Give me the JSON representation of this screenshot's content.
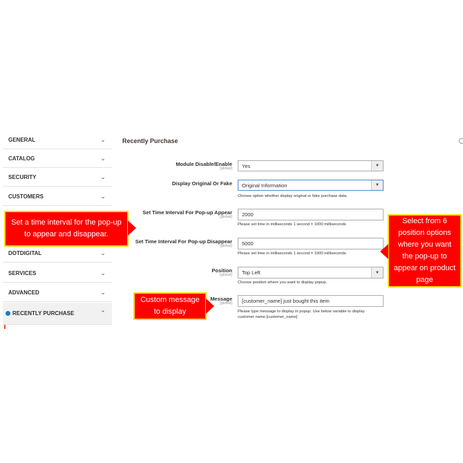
{
  "sidebar": {
    "items": [
      {
        "label": "GENERAL"
      },
      {
        "label": "CATALOG"
      },
      {
        "label": "SECURITY"
      },
      {
        "label": "CUSTOMERS"
      },
      {
        "label": "DOTDIGITAL"
      },
      {
        "label": "SERVICES"
      },
      {
        "label": "ADVANCED"
      },
      {
        "label": "RECENTLY PURCHASE"
      }
    ]
  },
  "section": {
    "title": "Recently Purchase"
  },
  "form": {
    "module": {
      "label": "Module Disable/Enable",
      "scope": "[global]",
      "value": "Yes"
    },
    "display": {
      "label": "Display Original Or Fake",
      "scope": "[global]",
      "value": "Original Information",
      "note": "Choose option whether display original or fake purchase data."
    },
    "appear": {
      "label": "Set Time Interval For Pop-up Appear",
      "scope": "[global]",
      "value": "2000",
      "note": "Please set time in milliseconds 1 second = 1000 milliseconds"
    },
    "disappear": {
      "label": "Set Time Interval For Pop-up Disappear",
      "scope": "[global]",
      "value": "5000",
      "note": "Please set time in milliseconds 1 second = 1000 milliseconds"
    },
    "position": {
      "label": "Position",
      "scope": "[global]",
      "value": "Top Left",
      "note": "Choose position where you want to display popup."
    },
    "message": {
      "label": "Message",
      "scope": "[global]",
      "value": "[customer_name] just bought this item",
      "note_line1": "Please type message to display in popup. Use below variable to display",
      "note_line2": "customer name.[customer_name]"
    }
  },
  "callouts": {
    "interval": "Set a time interval for the pop-up to appear and disappear.",
    "position": "Select from 6 position options where you want the pop-up to appear on product page",
    "message": "Custom message to display"
  },
  "colors": {
    "callout_bg": "#ff0000",
    "callout_border": "#ffd700",
    "accent": "#1979c3"
  }
}
